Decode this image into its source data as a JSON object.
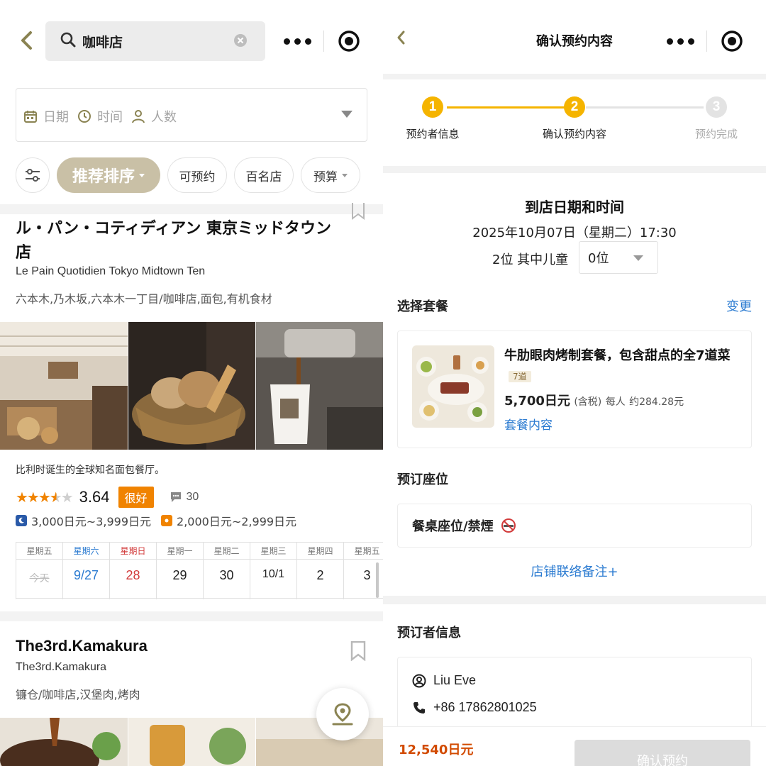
{
  "left": {
    "search": {
      "value": "咖啡店"
    },
    "filters": {
      "date": "日期",
      "time": "时间",
      "people": "人数"
    },
    "chips": [
      {
        "label": "推荐排序",
        "active": true
      },
      {
        "label": "可预约"
      },
      {
        "label": "百名店"
      },
      {
        "label": "预算"
      }
    ],
    "shop1": {
      "name_jp": "ル・パン・コティディアン 東京ミッドタウン店",
      "name_en": "Le Pain Quotidien Tokyo Midtown Ten",
      "tags": "六本木,乃木坂,六本木一丁目/咖啡店,面包,有机食材",
      "description": "比利时诞生的全球知名面包餐厅。",
      "rating": "3.64",
      "rating_badge": "很好",
      "comments": "30",
      "dinner_price": "3,000日元~3,999日元",
      "lunch_price": "2,000日元~2,999日元",
      "calendar": [
        {
          "weekday": "星期五",
          "date": "今天"
        },
        {
          "weekday": "星期六",
          "date": "9/27"
        },
        {
          "weekday": "星期日",
          "date": "28"
        },
        {
          "weekday": "星期一",
          "date": "29"
        },
        {
          "weekday": "星期二",
          "date": "30"
        },
        {
          "weekday": "星期三",
          "date": "10/1"
        },
        {
          "weekday": "星期四",
          "date": "2"
        },
        {
          "weekday": "星期五",
          "date": "3"
        }
      ]
    },
    "shop2": {
      "name": "The3rd.Kamakura",
      "name_en": "The3rd.Kamakura",
      "tags": "镰仓/咖啡店,汉堡肉,烤肉"
    }
  },
  "right": {
    "title": "确认预约内容",
    "steps": [
      {
        "num": "1",
        "label": "预约者信息",
        "state": "done"
      },
      {
        "num": "2",
        "label": "确认预约内容",
        "state": "current"
      },
      {
        "num": "3",
        "label": "预约完成",
        "state": "pending"
      }
    ],
    "visit": {
      "title": "到店日期和时间",
      "datetime": "2025年10月07日（星期二）17:30",
      "guests": "2位 其中儿童",
      "children": "0位"
    },
    "plan": {
      "section_label": "选择套餐",
      "change_label": "变更",
      "name": "牛肋眼肉烤制套餐，包含甜点的全7道菜",
      "course_badge": "7道",
      "price": "5,700日元",
      "tax": "(含税)",
      "per_person": "每人",
      "approx": "约284.28元",
      "detail_link": "套餐内容"
    },
    "seat": {
      "section_label": "预订座位",
      "value": "餐桌座位/禁煙",
      "note_link": "店铺联络备注+"
    },
    "booker": {
      "section_label": "预订者信息",
      "name": "Liu Eve",
      "phone": "+86 17862801025"
    },
    "bottom": {
      "total": "12,540日元",
      "confirm": "确认预约"
    }
  },
  "colors": {
    "accent_gold": "#f5b400",
    "link_blue": "#2b7bd1",
    "chip_active": "#c9c0a6",
    "badge_orange": "#f08300"
  }
}
